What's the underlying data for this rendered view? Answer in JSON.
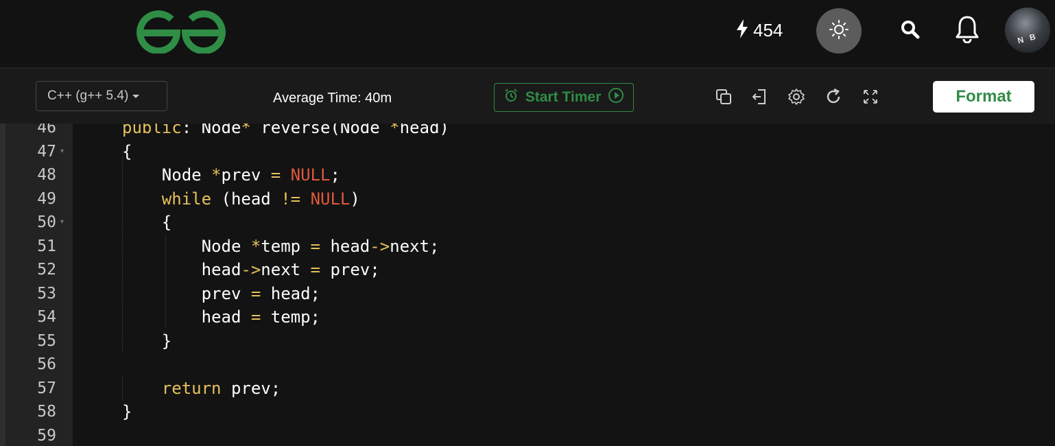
{
  "nav": {
    "logo": "geeksforgeeks-logo",
    "streak_icon": "lightning-icon",
    "streak_count": "454",
    "theme_icon": "sun-icon",
    "search_icon": "search-icon",
    "notification_icon": "bell-icon",
    "avatar_initials": "N B"
  },
  "toolbar": {
    "language": "C++ (g++ 5.4)",
    "average_time": "Average Time: 40m",
    "start_timer_label": "Start Timer",
    "icons": [
      "copy-icon",
      "exit-icon",
      "settings-icon",
      "reset-icon",
      "fullscreen-icon"
    ],
    "format_label": "Format"
  },
  "editor": {
    "lines": [
      {
        "number": "46",
        "tokens": [
          {
            "t": "public",
            "c": "kw"
          },
          {
            "t": ": Node"
          },
          {
            "t": "*",
            "c": "op"
          },
          {
            "t": " reverse(Node "
          },
          {
            "t": "*",
            "c": "op"
          },
          {
            "t": "head)"
          }
        ]
      },
      {
        "number": "47",
        "fold": true,
        "tokens": [
          {
            "t": "{"
          }
        ]
      },
      {
        "number": "48",
        "tokens": [
          {
            "t": "    Node "
          },
          {
            "t": "*",
            "c": "op"
          },
          {
            "t": "prev "
          },
          {
            "t": "=",
            "c": "op"
          },
          {
            "t": " "
          },
          {
            "t": "NULL",
            "c": "nul"
          },
          {
            "t": ";"
          }
        ]
      },
      {
        "number": "49",
        "tokens": [
          {
            "t": "    "
          },
          {
            "t": "while",
            "c": "kw"
          },
          {
            "t": " (head "
          },
          {
            "t": "!=",
            "c": "op"
          },
          {
            "t": " "
          },
          {
            "t": "NULL",
            "c": "nul"
          },
          {
            "t": ")"
          }
        ]
      },
      {
        "number": "50",
        "fold": true,
        "tokens": [
          {
            "t": "    {"
          }
        ]
      },
      {
        "number": "51",
        "tokens": [
          {
            "t": "        Node "
          },
          {
            "t": "*",
            "c": "op"
          },
          {
            "t": "temp "
          },
          {
            "t": "=",
            "c": "op"
          },
          {
            "t": " head"
          },
          {
            "t": "->",
            "c": "op"
          },
          {
            "t": "next;"
          }
        ]
      },
      {
        "number": "52",
        "tokens": [
          {
            "t": "        head"
          },
          {
            "t": "->",
            "c": "op"
          },
          {
            "t": "next "
          },
          {
            "t": "=",
            "c": "op"
          },
          {
            "t": " prev;"
          }
        ]
      },
      {
        "number": "53",
        "tokens": [
          {
            "t": "        prev "
          },
          {
            "t": "=",
            "c": "op"
          },
          {
            "t": " head;"
          }
        ]
      },
      {
        "number": "54",
        "tokens": [
          {
            "t": "        head "
          },
          {
            "t": "=",
            "c": "op"
          },
          {
            "t": " temp;"
          }
        ]
      },
      {
        "number": "55",
        "tokens": [
          {
            "t": "    }"
          }
        ]
      },
      {
        "number": "56",
        "tokens": []
      },
      {
        "number": "57",
        "tokens": [
          {
            "t": "    "
          },
          {
            "t": "return",
            "c": "kw"
          },
          {
            "t": " prev;"
          }
        ]
      },
      {
        "number": "58",
        "tokens": [
          {
            "t": "}"
          }
        ]
      },
      {
        "number": "59",
        "tokens": []
      }
    ]
  },
  "colors": {
    "brand_green": "#2f8d46",
    "keyword": "#e6c15b",
    "constant": "#e0583b",
    "background": "#131313"
  }
}
